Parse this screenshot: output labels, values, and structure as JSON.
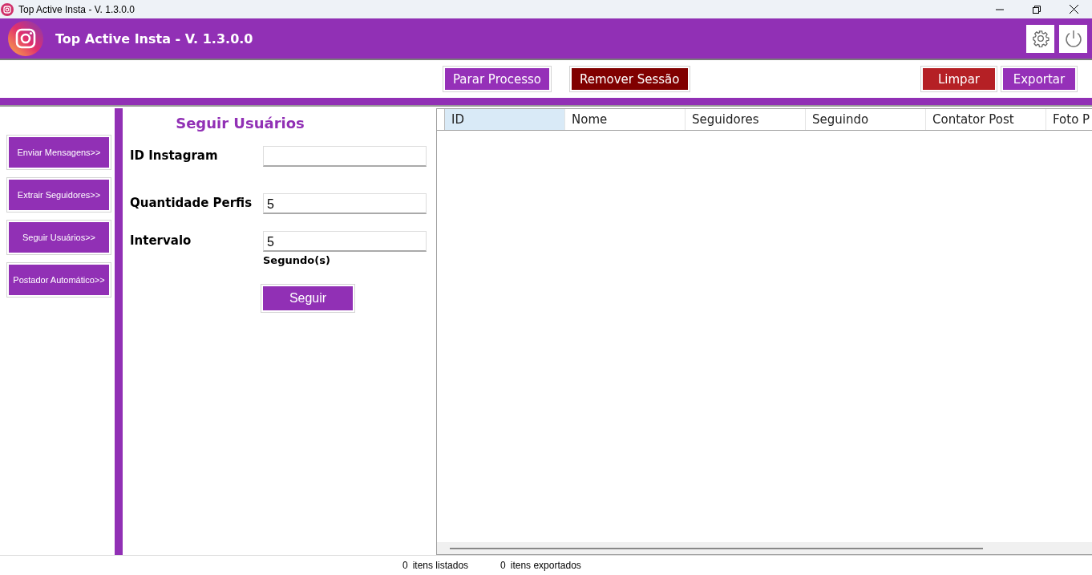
{
  "window": {
    "title": "Top Active Insta - V. 1.3.0.0"
  },
  "header": {
    "title": "Top Active Insta - V. 1.3.0.0"
  },
  "toolbar": {
    "left_buttons": [
      {
        "label": "Parar Processo",
        "kind": "primary"
      },
      {
        "label": "Remover Sessão",
        "kind": "danger"
      }
    ],
    "right_buttons": [
      {
        "label": "Limpar",
        "kind": "warning"
      },
      {
        "label": "Exportar",
        "kind": "primary"
      }
    ]
  },
  "sidebar": {
    "items": [
      {
        "label": "Enviar Mensagens>>"
      },
      {
        "label": "Extrair Seguidores>>"
      },
      {
        "label": "Seguir Usuários>>"
      },
      {
        "label": "Postador Automático>>"
      }
    ]
  },
  "form": {
    "title": "Seguir Usuários",
    "fields": [
      {
        "label": "ID Instagram"
      },
      {
        "label": "Quantidade Perfis",
        "value": "5"
      },
      {
        "label": "Intervalo",
        "value": "5",
        "suffix": "Segundo(s)"
      }
    ],
    "submit": "Seguir"
  },
  "table": {
    "columns": [
      {
        "label": "ID",
        "selected": true
      },
      {
        "label": "Nome",
        "selected": false
      },
      {
        "label": "Seguidores",
        "selected": false
      },
      {
        "label": "Seguindo",
        "selected": false
      },
      {
        "label": "Contator Post",
        "selected": false
      },
      {
        "label": "Foto P",
        "selected": false
      }
    ]
  },
  "status_bar": [
    {
      "count": "0",
      "label": "itens listados"
    },
    {
      "count": "0",
      "label": "itens exportados"
    }
  ]
}
